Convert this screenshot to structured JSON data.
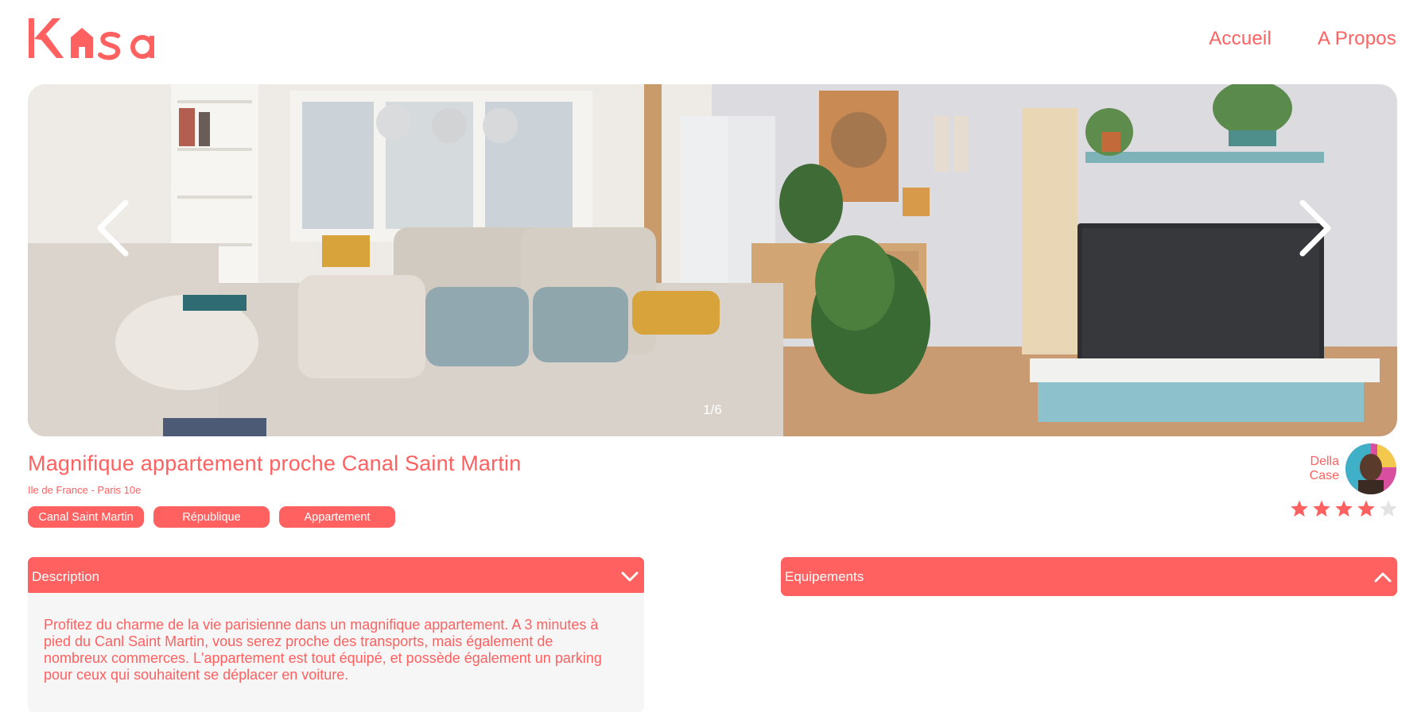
{
  "header": {
    "logo_text": "Kasa",
    "nav": [
      {
        "label": "Accueil"
      },
      {
        "label": "A Propos"
      }
    ]
  },
  "carousel": {
    "counter": "1/6",
    "image": "living-room-photo",
    "prev_icon": "chevron-left-icon",
    "next_icon": "chevron-right-icon"
  },
  "listing": {
    "title": "Magnifique appartement proche Canal Saint Martin",
    "location": "Ile de France - Paris 10e",
    "tags": [
      "Canal Saint Martin",
      "République",
      "Appartement"
    ],
    "host": {
      "first_name": "Della",
      "last_name": "Case"
    },
    "rating": 4,
    "rating_max": 5
  },
  "collapses": {
    "description": {
      "title": "Description",
      "icon": "chevron-down-icon",
      "content": "Profitez du charme de la vie parisienne dans un magnifique appartement. A 3 minutes à pied du Canl Saint Martin, vous serez proche des transports, mais également de nombreux commerces. L'appartement est tout équipé, et possède également un parking pour ceux qui souhaitent se déplacer en voiture."
    },
    "equipements": {
      "title": "Equipements",
      "icon": "chevron-up-icon"
    }
  },
  "colors": {
    "brand": "#FF6060",
    "panel": "#F6F6F6",
    "star_empty": "#E3E3E3"
  }
}
